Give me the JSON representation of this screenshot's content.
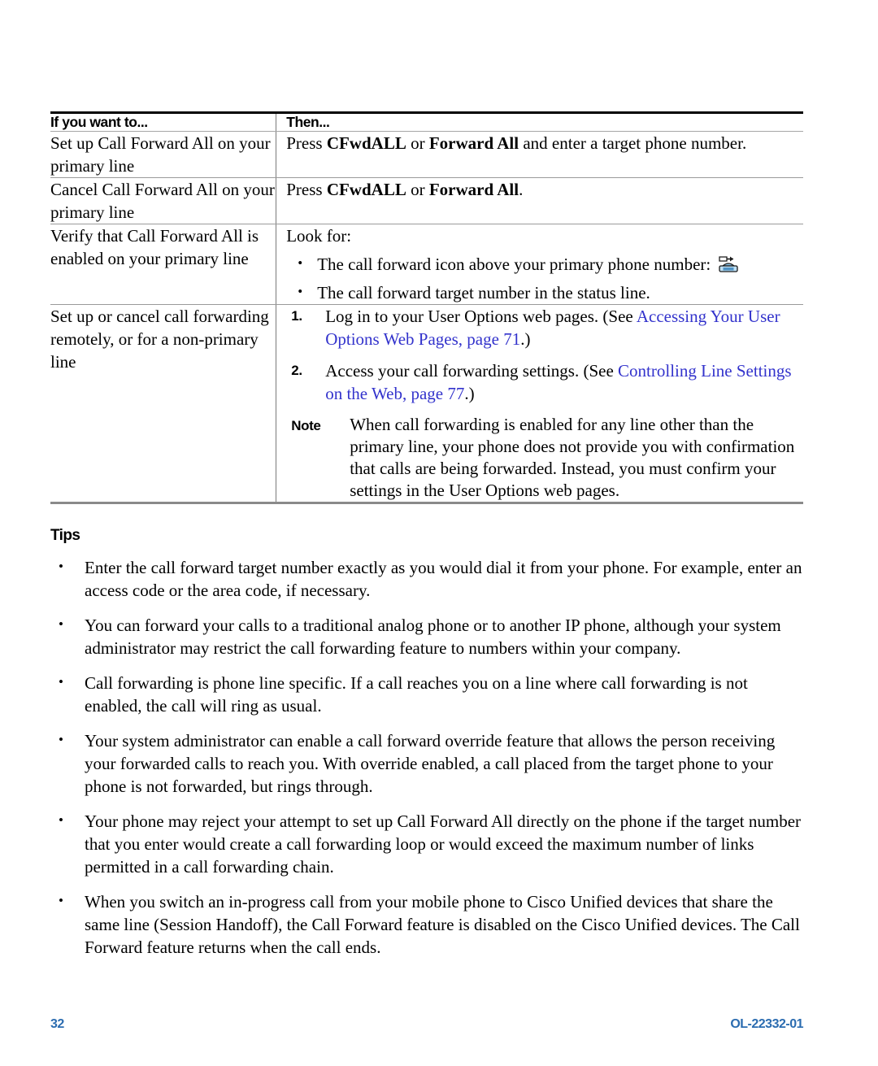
{
  "table": {
    "headers": [
      "If you want to...",
      "Then..."
    ],
    "rows": [
      {
        "task": "Set up Call Forward All on your primary line",
        "action_prefix": "Press ",
        "action_b1": "CFwdALL",
        "action_mid": " or ",
        "action_b2": "Forward All",
        "action_suffix": " and enter a target phone number."
      },
      {
        "task": "Cancel Call Forward All on your primary line",
        "action_prefix": "Press ",
        "action_b1": "CFwdALL",
        "action_mid": " or ",
        "action_b2": "Forward All",
        "action_suffix": "."
      },
      {
        "task": "Verify that Call Forward All is enabled on your primary line",
        "lead": "Look for:",
        "bullets": [
          "The call forward icon above your primary phone number:",
          "The call forward target number in the status line."
        ],
        "icon": "call-forward-phone-icon"
      },
      {
        "task": "Set up or cancel call forwarding remotely, or for a non-primary line",
        "steps": [
          {
            "num": "1.",
            "text_before": "Log in to your User Options web pages. (See ",
            "link": "Accessing Your User Options Web Pages, page 71",
            "text_after": ".)"
          },
          {
            "num": "2.",
            "text_before": "Access your call forwarding settings. (See ",
            "link": "Controlling Line Settings on the Web, page 77",
            "text_after": ".)"
          }
        ],
        "note_label": "Note",
        "note_text": "When call forwarding is enabled for any line other than the primary line, your phone does not provide you with confirmation that calls are being forwarded. Instead, you must confirm your settings in the User Options web pages."
      }
    ]
  },
  "tips": {
    "heading": "Tips",
    "items": [
      "Enter the call forward target number exactly as you would dial it from your phone. For example, enter an access code or the area code, if necessary.",
      "You can forward your calls to a traditional analog phone or to another IP phone, although your system administrator may restrict the call forwarding feature to numbers within your company.",
      "Call forwarding is phone line specific. If a call reaches you on a line where call forwarding is not enabled, the call will ring as usual.",
      "Your system administrator can enable a call forward override feature that allows the person receiving your forwarded calls to reach you. With override enabled, a call placed from the target phone to your phone is not forwarded, but rings through.",
      "Your phone may reject your attempt to set up Call Forward All directly on the phone if the target number that you enter would create a call forwarding loop or would exceed the maximum number of links permitted in a call forwarding chain.",
      "When you switch an in-progress call from your mobile phone to Cisco Unified devices that share the same line (Session Handoff), the Call Forward feature is disabled on the Cisco Unified devices. The Call Forward feature returns when the call ends."
    ],
    "bullet_glyph": "•"
  },
  "footer": {
    "page_number": "32",
    "document_id": "OL-22332-01",
    "color": "#2b6cb0"
  },
  "colors": {
    "link": "#3333cc",
    "rule_dark": "#000000",
    "rule_gray": "#9a9a9a"
  }
}
